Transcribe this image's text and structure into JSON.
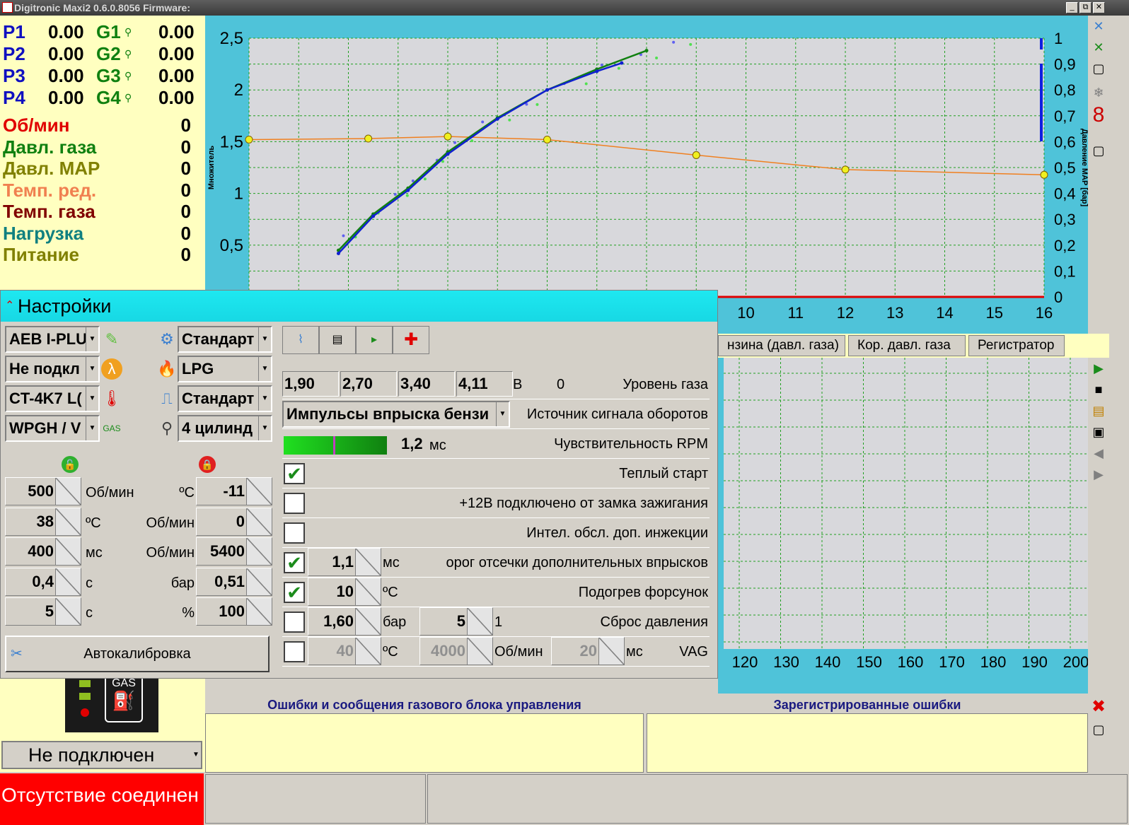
{
  "window": {
    "title": "Digitronic Maxi2 0.6.0.8056 Firmware:",
    "btn_min": "_",
    "btn_max": "⧉",
    "btn_close": "✕"
  },
  "injectors": [
    {
      "p_label": "P1",
      "p_value": "0.00",
      "g_label": "G1",
      "g_value": "0.00"
    },
    {
      "p_label": "P2",
      "p_value": "0.00",
      "g_label": "G2",
      "g_value": "0.00"
    },
    {
      "p_label": "P3",
      "p_value": "0.00",
      "g_label": "G3",
      "g_value": "0.00"
    },
    {
      "p_label": "P4",
      "p_value": "0.00",
      "g_label": "G4",
      "g_value": "0.00"
    }
  ],
  "sensors": [
    {
      "label": "Об/мин",
      "value": "0",
      "color": "#e00000"
    },
    {
      "label": "Давл. газа",
      "value": "0",
      "color": "#108010"
    },
    {
      "label": "Давл. MAP",
      "value": "0",
      "color": "#808000"
    },
    {
      "label": "Темп. ред.",
      "value": "0",
      "color": "#f08050"
    },
    {
      "label": "Темп. газа",
      "value": "0",
      "color": "#800000"
    },
    {
      "label": "Нагрузка",
      "value": "0",
      "color": "#108080"
    },
    {
      "label": "Питание",
      "value": "0",
      "color": "#808000"
    }
  ],
  "chart_data": [
    {
      "type": "line",
      "ylabel": "Множитель",
      "y2label": "Давление MAP [бар]",
      "ylim": [
        0,
        2.5
      ],
      "y2lim": [
        0,
        1
      ],
      "xlim": [
        0,
        16
      ],
      "yticks": [
        "0,5",
        "1",
        "1,5",
        "2",
        "2,5"
      ],
      "y2ticks": [
        "0",
        "0,1",
        "0,2",
        "0,3",
        "0,4",
        "0,5",
        "0,6",
        "0,7",
        "0,8",
        "0,9",
        "1"
      ],
      "xticks_visible": [
        "10",
        "11",
        "12",
        "13",
        "14",
        "15",
        "16"
      ],
      "series": [
        {
          "name": "",
          "color": "#f08020",
          "x": [
            0,
            2.4,
            4,
            6,
            9,
            12,
            16
          ],
          "y": [
            1.52,
            1.53,
            1.55,
            1.52,
            1.37,
            1.23,
            1.18
          ]
        },
        {
          "name": "",
          "color": "#108010",
          "x": [
            1.8,
            2.5,
            3.2,
            4,
            5,
            6,
            7,
            8
          ],
          "y": [
            0.45,
            0.8,
            1.05,
            1.4,
            1.73,
            2.0,
            2.2,
            2.38
          ]
        },
        {
          "name": "",
          "color": "#1020d0",
          "x": [
            1.8,
            2.5,
            3.2,
            4,
            5,
            6,
            7,
            7.5
          ],
          "y": [
            0.42,
            0.78,
            1.03,
            1.38,
            1.72,
            2.0,
            2.18,
            2.26
          ]
        }
      ]
    },
    {
      "type": "line",
      "xticks_visible": [
        "120",
        "130",
        "140",
        "150",
        "160",
        "170",
        "180",
        "190",
        "200"
      ],
      "series": []
    }
  ],
  "tabs": {
    "tab1": "нзина (давл. газа)",
    "tab2": "Кор. давл. газа",
    "tab3": "Регистратор"
  },
  "settings": {
    "title": "Настройки",
    "combos_left": [
      "AEB I-PLU",
      "Не подкл",
      "CT-4K7 L(",
      "WPGH / V"
    ],
    "combos_right": [
      "Стандарт",
      "LPG",
      "Стандарт",
      "4 цилинд"
    ],
    "spins_left": [
      {
        "value": "500",
        "unit": "Об/мин"
      },
      {
        "value": "38",
        "unit": "ºC"
      },
      {
        "value": "400",
        "unit": "мс"
      },
      {
        "value": "0,4",
        "unit": "с"
      },
      {
        "value": "5",
        "unit": "с"
      }
    ],
    "spins_right": [
      {
        "value": "-11",
        "unit": "ºC"
      },
      {
        "value": "0",
        "unit": "Об/мин"
      },
      {
        "value": "5400",
        "unit": "Об/мин"
      },
      {
        "value": "0,51",
        "unit": "бар"
      },
      {
        "value": "100",
        "unit": "%"
      }
    ],
    "autocal": "Автокалибровка",
    "gas_level": {
      "v1": "1,90",
      "v2": "2,70",
      "v3": "3,40",
      "v4": "4,11",
      "unit": "B",
      "current": "0",
      "label": "Уровень газа"
    },
    "rpm_source": {
      "value": "Импульсы впрыска бензи",
      "label": "Источник сигнала оборотов"
    },
    "rpm_sens": {
      "value": "1,2",
      "unit": "мс",
      "label": "Чувствительность RPM",
      "level": 0.48
    },
    "warm_start": {
      "label": "Теплый старт",
      "checked": "✔"
    },
    "plus12": {
      "label": "+12B подключено от замка зажигания",
      "checked": ""
    },
    "intel": {
      "label": "Интел. обсл. доп. инжекции",
      "checked": ""
    },
    "cutoff": {
      "value": "1,1",
      "unit": "мс",
      "label": "орог отсечки дополнительных впрысков",
      "checked": "✔"
    },
    "heat": {
      "value": "10",
      "unit": "ºC",
      "label": "Подогрев форсунок",
      "checked": "✔"
    },
    "reset": {
      "value": "1,60",
      "unit": "бар",
      "value2": "5",
      "unit2": "1",
      "label": "Сброс давления",
      "checked": ""
    },
    "vag": {
      "value": "40",
      "unit": "ºC",
      "value2": "4000",
      "unit2": "Об/мин",
      "value3": "20",
      "unit3": "мс",
      "label": "VAG",
      "checked": ""
    }
  },
  "gas_indicator": {
    "text": "GAS"
  },
  "connection": {
    "value": "Не подключен"
  },
  "errors": {
    "left_title": "Ошибки и сообщения газового блока управления",
    "right_title": "Зарегистрированные ошибки"
  },
  "status": {
    "text": "Отсутствие соединен"
  }
}
